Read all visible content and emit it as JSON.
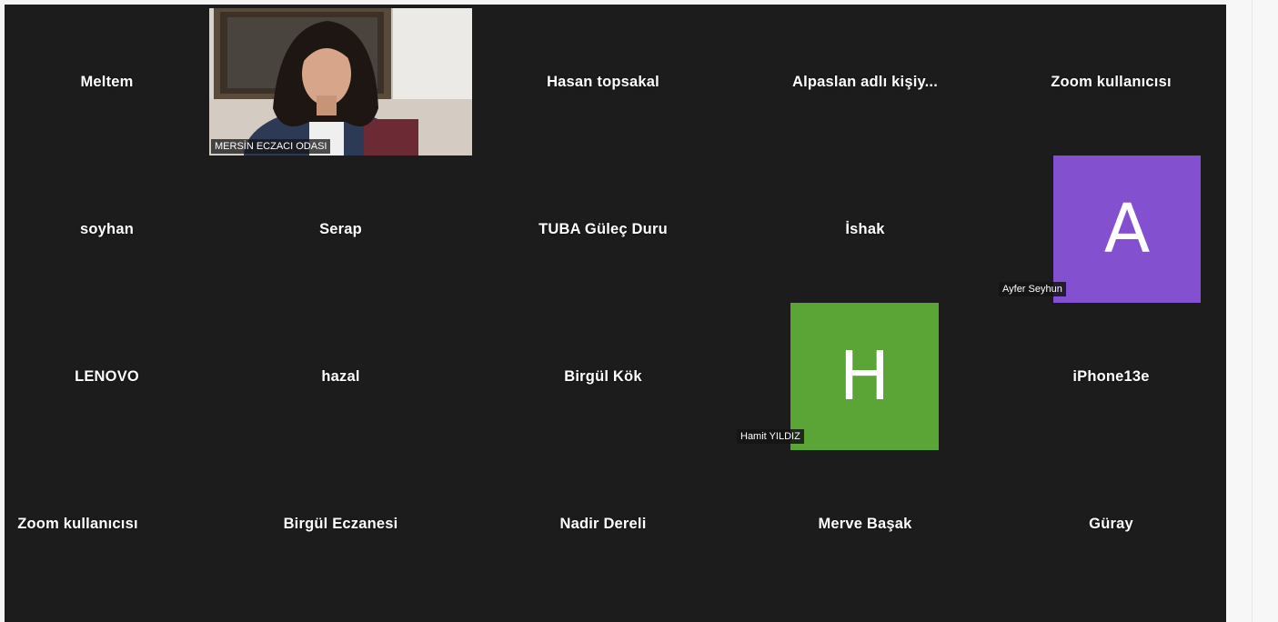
{
  "participants": {
    "row1": [
      "Meltem",
      "Hasan topsakal",
      "Alpaslan adlı kişiy...",
      "Zoom kullanıcısı"
    ],
    "row2": [
      "soyhan",
      "Serap",
      "TUBA Güleç Duru",
      "İshak"
    ],
    "row3": [
      "LENOVO",
      "hazal",
      "Birgül Kök",
      "iPhone13e"
    ],
    "row4": [
      "Zoom kullanıcısı",
      "Birgül Eczanesi",
      "Nadir Dereli",
      "Merve Başak",
      "Güray"
    ]
  },
  "video": {
    "label": "MERSİN ECZACI ODASI"
  },
  "avatars": {
    "ayfer": {
      "letter": "A",
      "label": "Ayfer Seyhun",
      "color": "#8350cf"
    },
    "hamit": {
      "letter": "H",
      "label": "Hamit YILDIZ",
      "color": "#5aa535"
    }
  },
  "colors": {
    "background": "#1c1c1c"
  }
}
